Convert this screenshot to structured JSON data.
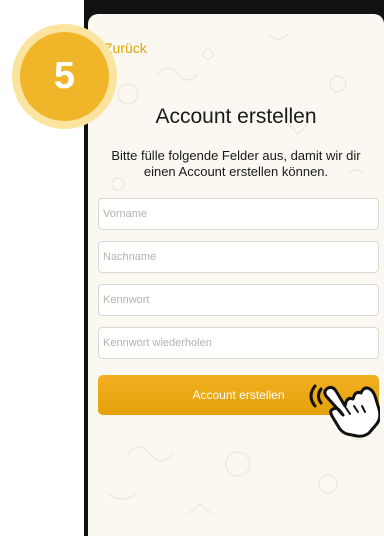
{
  "tutorial": {
    "step_number": "5"
  },
  "nav": {
    "back_label": "Zurück"
  },
  "screen": {
    "title": "Account erstellen",
    "subtitle": "Bitte fülle folgende Felder aus, damit wir dir einen Account erstellen können."
  },
  "form": {
    "fields": [
      {
        "placeholder": "Vorname",
        "value": ""
      },
      {
        "placeholder": "Nachname",
        "value": ""
      },
      {
        "placeholder": "Kennwort",
        "value": ""
      },
      {
        "placeholder": "Kennwort wiederholen",
        "value": ""
      }
    ],
    "submit_label": "Account erstellen"
  },
  "icons": {
    "pointer": "tap-hand-icon"
  },
  "colors": {
    "accent": "#e3a400",
    "button": "#f2b021",
    "badge": "#f1b52a",
    "badge_ring": "#fbe3a0",
    "screen_bg": "#fbf8f1"
  }
}
